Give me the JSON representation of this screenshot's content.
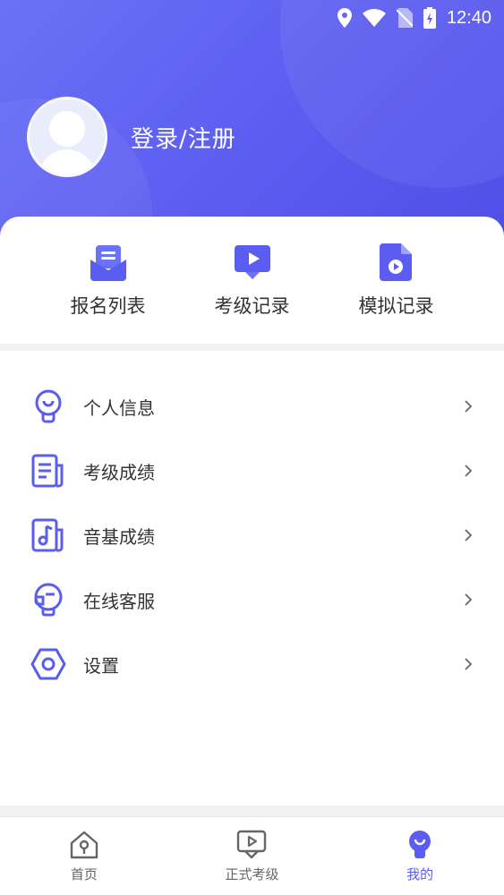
{
  "status_bar": {
    "time": "12:40"
  },
  "profile": {
    "login_label": "登录/注册"
  },
  "quick_actions": [
    {
      "label": "报名列表",
      "icon": "mail-open-icon"
    },
    {
      "label": "考级记录",
      "icon": "video-play-icon"
    },
    {
      "label": "模拟记录",
      "icon": "file-video-icon"
    }
  ],
  "menu": [
    {
      "label": "个人信息",
      "icon": "user-pin-icon"
    },
    {
      "label": "考级成绩",
      "icon": "document-icon"
    },
    {
      "label": "音基成绩",
      "icon": "music-doc-icon"
    },
    {
      "label": "在线客服",
      "icon": "headset-icon"
    },
    {
      "label": "设置",
      "icon": "settings-hex-icon"
    }
  ],
  "tabs": [
    {
      "label": "首页",
      "icon": "home-icon",
      "active": false
    },
    {
      "label": "正式考级",
      "icon": "exam-play-icon",
      "active": false
    },
    {
      "label": "我的",
      "icon": "profile-bulb-icon",
      "active": true
    }
  ],
  "colors": {
    "accent": "#5b5cf0",
    "accent_light": "#6a72f6"
  }
}
